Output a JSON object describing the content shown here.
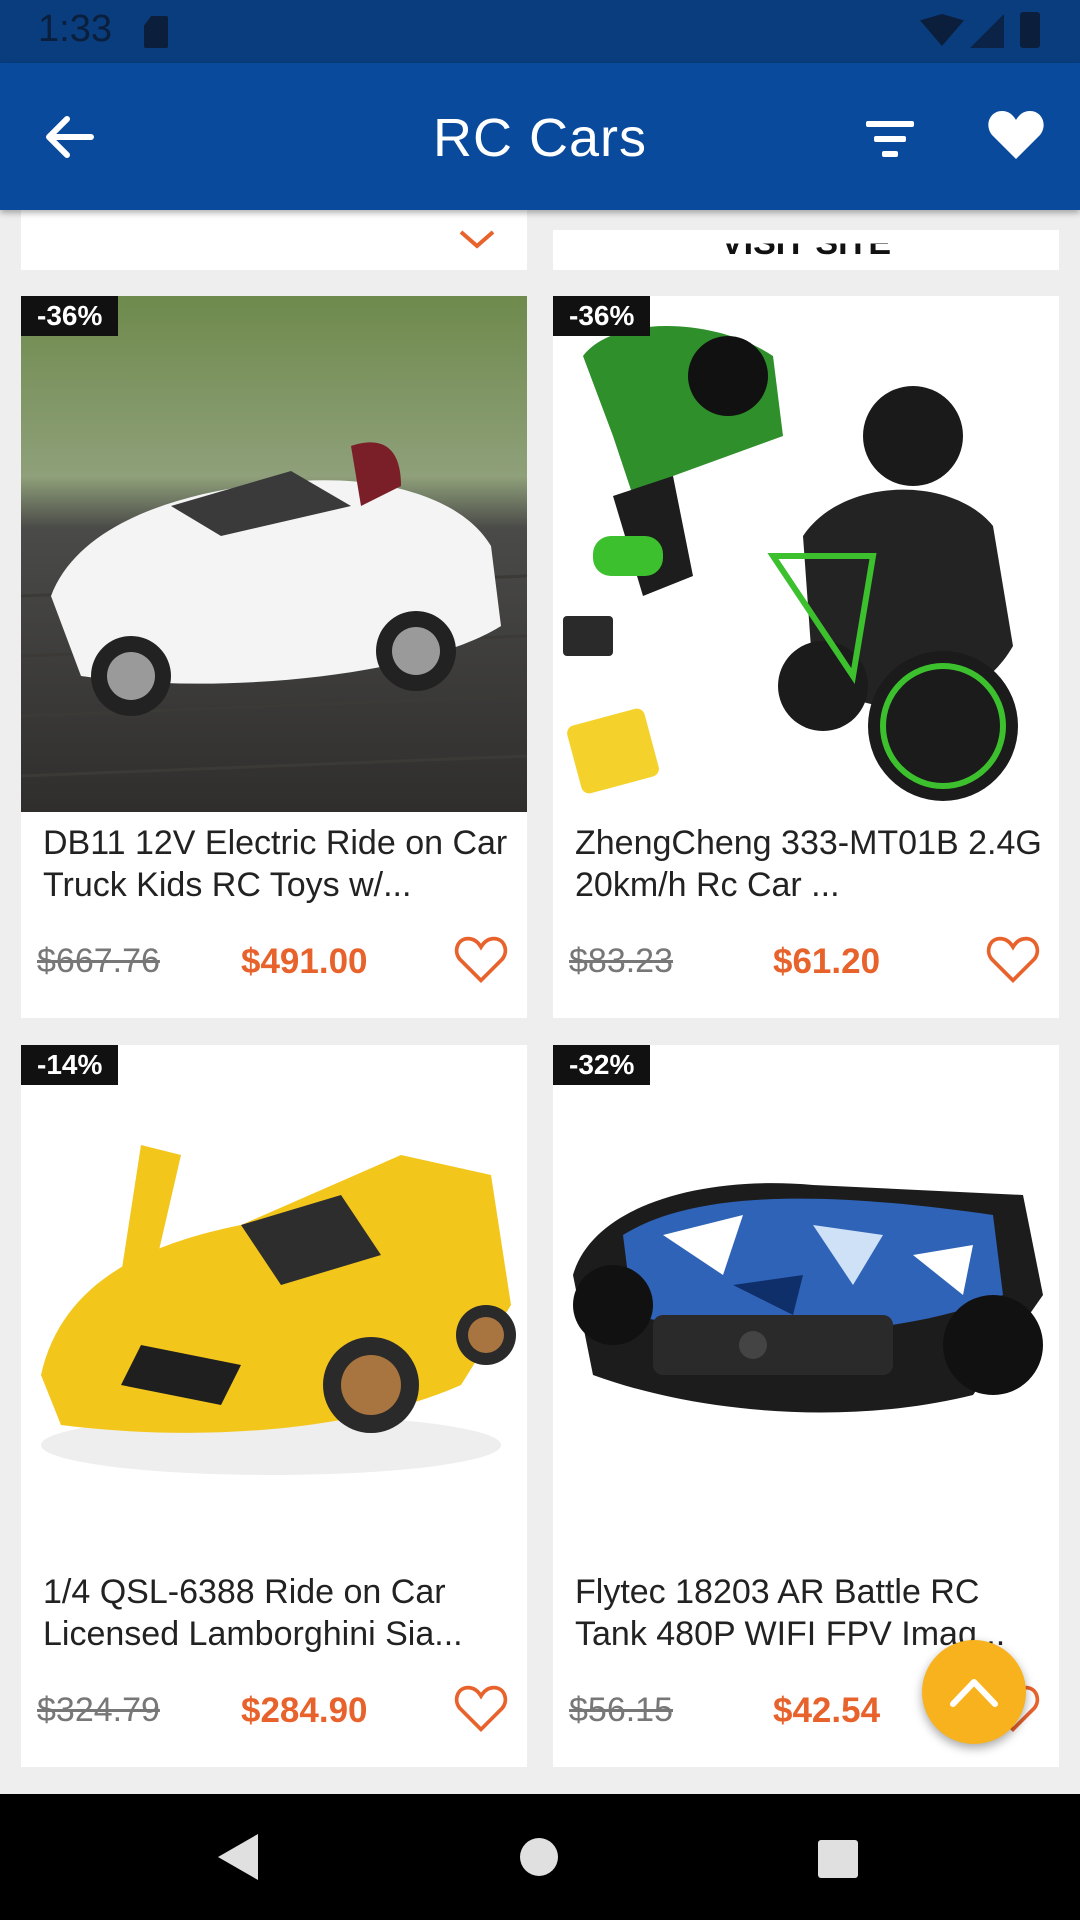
{
  "status_bar": {
    "time": "1:33"
  },
  "app_bar": {
    "title": "RC Cars"
  },
  "partial_cards": {
    "right_label": "VISIT SITE"
  },
  "products": [
    {
      "discount": "-36%",
      "title": "DB11 12V Electric Ride on Car Truck Kids RC Toys w/...",
      "old_price": "$667.76",
      "new_price": "$491.00",
      "image": "white ride-on sports car"
    },
    {
      "discount": "-36%",
      "title": "ZhengCheng 333-MT01B 2.4G 20km/h Rc Car ...",
      "old_price": "$83.23",
      "new_price": "$61.20",
      "image": "black and green rc motorcycle with remote"
    },
    {
      "discount": "-14%",
      "title": "1/4 QSL-6388 Ride on Car Licensed Lamborghini Sia...",
      "old_price": "$324.79",
      "new_price": "$284.90",
      "image": "yellow ride-on lamborghini"
    },
    {
      "discount": "-32%",
      "title": "Flytec 18203 AR Battle RC Tank 480P WIFI FPV Imag...",
      "old_price": "$56.15",
      "new_price": "$42.54",
      "image": "camouflage rc tank"
    }
  ],
  "colors": {
    "app_bar": "#0a4a9c",
    "status_bar": "#0a3d7d",
    "price": "#e8622c",
    "fab": "#f8b21d"
  },
  "icons": [
    "arrow-left-icon",
    "filter-icon",
    "heart-filled-icon",
    "heart-outline-icon",
    "chevron-up-icon"
  ]
}
